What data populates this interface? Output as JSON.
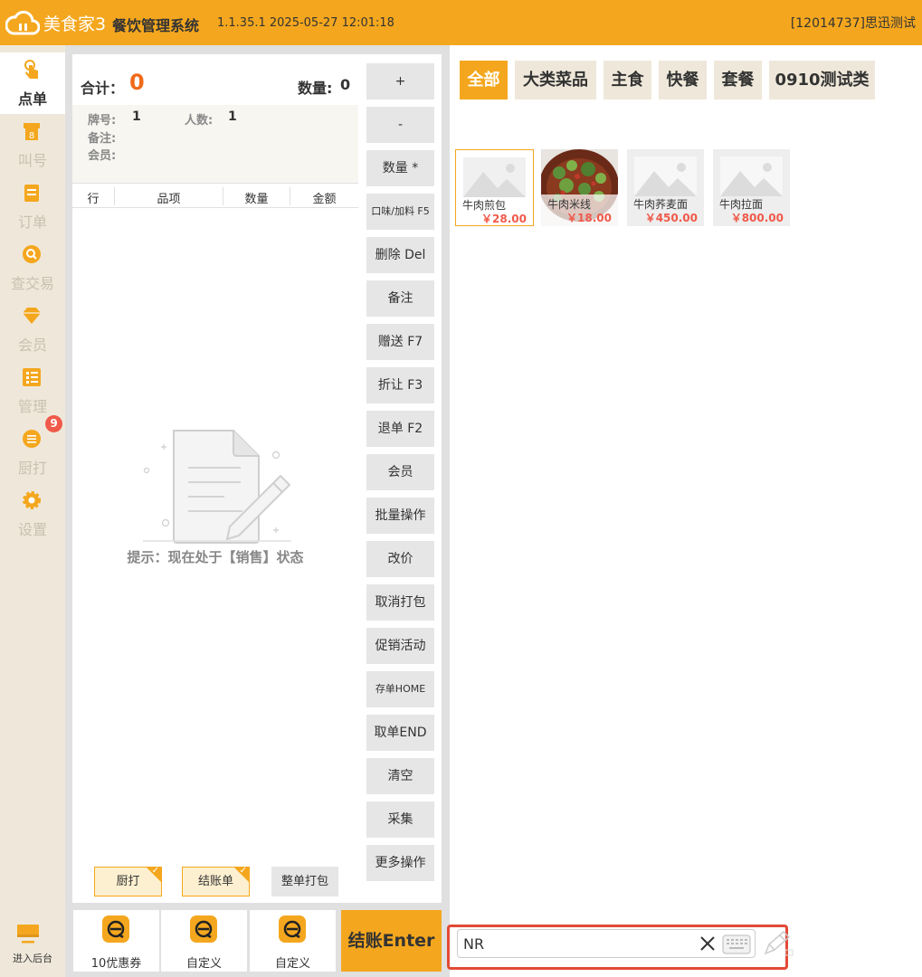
{
  "header": {
    "brand": "美食家3",
    "system_title": "餐饮管理系统",
    "version": "1.1.35.1 2025-05-27 12:01:18",
    "account": "[12014737]思迅测试"
  },
  "sidebar": {
    "items": [
      {
        "label": "点单",
        "icon": "tap-icon",
        "active": true
      },
      {
        "label": "叫号",
        "icon": "queue-number-icon"
      },
      {
        "label": "订单",
        "icon": "order-icon"
      },
      {
        "label": "查交易",
        "icon": "search-transaction-icon"
      },
      {
        "label": "会员",
        "icon": "diamond-icon"
      },
      {
        "label": "管理",
        "icon": "checklist-icon"
      },
      {
        "label": "厨打",
        "icon": "kitchen-print-icon",
        "badge": "9"
      },
      {
        "label": "设置",
        "icon": "gear-icon"
      }
    ],
    "backend_label": "进入后台"
  },
  "order": {
    "sum_label": "合计：",
    "sum_value": "0",
    "qty_label": "数量:",
    "qty_value": "0",
    "info": {
      "plate_label": "牌号:",
      "plate_value": "1",
      "people_label": "人数:",
      "people_value": "1",
      "note_label": "备注:",
      "member_label": "会员:"
    },
    "columns": [
      "行",
      "品项",
      "数量",
      "金额"
    ],
    "empty_tip": "提示：现在处于【销售】状态",
    "toggles": [
      {
        "label": "厨打",
        "checked": true
      },
      {
        "label": "结账单",
        "checked": true
      },
      {
        "label": "整单打包",
        "checked": false
      }
    ]
  },
  "functions": [
    "+",
    "-",
    "数量 *",
    "口味/加料 F5",
    "删除 Del",
    "备注",
    "赠送 F7",
    "折让 F3",
    "退单 F2",
    "会员",
    "批量操作",
    "改价",
    "取消打包",
    "促销活动",
    "存单HOME",
    "取单END",
    "清空",
    "采集",
    "更多操作"
  ],
  "bottom": {
    "cards": [
      "10优惠券",
      "自定义",
      "自定义"
    ],
    "checkout": "结账Enter"
  },
  "categories": [
    {
      "label": "全部",
      "active": true
    },
    {
      "label": "大类菜品"
    },
    {
      "label": "主食"
    },
    {
      "label": "快餐"
    },
    {
      "label": "套餐"
    },
    {
      "label": "0910测试类"
    }
  ],
  "dishes": [
    {
      "name": "牛肉煎包",
      "price": "￥28.00",
      "selected": true,
      "photo": false
    },
    {
      "name": "牛肉米线",
      "price": "￥18.00",
      "photo": true
    },
    {
      "name": "牛肉荞麦面",
      "price": "￥450.00",
      "photo": false
    },
    {
      "name": "牛肉拉面",
      "price": "￥800.00",
      "photo": false
    }
  ],
  "search": {
    "value": "NR"
  },
  "colors": {
    "accent": "#f4a71e",
    "price": "#f05a4a",
    "total": "#f06a1b",
    "highlight": "#e34a36"
  }
}
